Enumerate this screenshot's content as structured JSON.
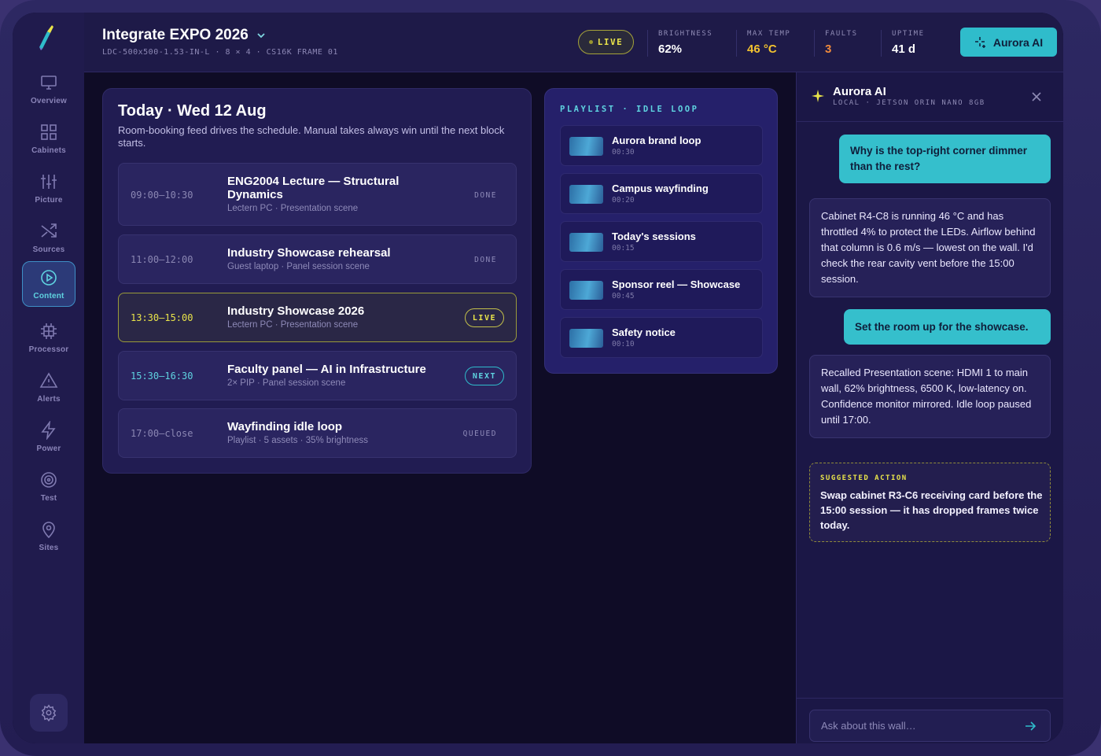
{
  "nav": {
    "items": [
      {
        "label": "Overview",
        "icon": "monitor-icon"
      },
      {
        "label": "Cabinets",
        "icon": "grid-icon"
      },
      {
        "label": "Picture",
        "icon": "sliders-icon"
      },
      {
        "label": "Sources",
        "icon": "shuffle-icon"
      },
      {
        "label": "Content",
        "icon": "play-circle-icon",
        "active": true
      },
      {
        "label": "Processor",
        "icon": "chip-icon"
      },
      {
        "label": "Alerts",
        "icon": "warning-icon"
      },
      {
        "label": "Power",
        "icon": "bolt-icon"
      },
      {
        "label": "Test",
        "icon": "target-icon"
      },
      {
        "label": "Sites",
        "icon": "map-pin-icon"
      }
    ]
  },
  "header": {
    "title": "Integrate EXPO 2026",
    "subtitle": "LDC-500x500-1.53-IN-L · 8 × 4 · CS16K FRAME 01",
    "live_label": "LIVE",
    "stats": [
      {
        "label": "BRIGHTNESS",
        "value": "62%",
        "color": "#ffffff"
      },
      {
        "label": "MAX TEMP",
        "value": "46 °C",
        "color": "#f2c230"
      },
      {
        "label": "FAULTS",
        "value": "3",
        "color": "#f08a3c"
      },
      {
        "label": "UPTIME",
        "value": "41 d",
        "color": "#ffffff"
      }
    ],
    "ai_button": "Aurora AI"
  },
  "schedule": {
    "title": "Today · Wed 12 Aug",
    "description": "Room-booking feed drives the schedule. Manual takes always win until the next block starts.",
    "rows": [
      {
        "time": "09:00–10:30",
        "title": "ENG2004 Lecture — Structural Dynamics",
        "sub": "Lectern PC · Presentation scene",
        "status": "DONE",
        "kind": "done"
      },
      {
        "time": "11:00–12:00",
        "title": "Industry Showcase rehearsal",
        "sub": "Guest laptop · Panel session scene",
        "status": "DONE",
        "kind": "done"
      },
      {
        "time": "13:30–15:00",
        "title": "Industry Showcase 2026",
        "sub": "Lectern PC · Presentation scene",
        "status": "LIVE",
        "kind": "live"
      },
      {
        "time": "15:30–16:30",
        "title": "Faculty panel — AI in Infrastructure",
        "sub": "2× PIP · Panel session scene",
        "status": "NEXT",
        "kind": "next"
      },
      {
        "time": "17:00–close",
        "title": "Wayfinding idle loop",
        "sub": "Playlist · 5 assets · 35% brightness",
        "status": "QUEUED",
        "kind": "queued"
      }
    ]
  },
  "playlist": {
    "header": "PLAYLIST · IDLE LOOP",
    "items": [
      {
        "name": "Aurora brand loop",
        "duration": "00:30"
      },
      {
        "name": "Campus wayfinding",
        "duration": "00:20"
      },
      {
        "name": "Today's sessions",
        "duration": "00:15"
      },
      {
        "name": "Sponsor reel — Showcase",
        "duration": "00:45"
      },
      {
        "name": "Safety notice",
        "duration": "00:10"
      }
    ]
  },
  "ai": {
    "title": "Aurora AI",
    "subtitle": "LOCAL · JETSON ORIN NANO 8GB",
    "messages": [
      {
        "role": "user",
        "text": "Why is the top-right corner dimmer than the rest?"
      },
      {
        "role": "assistant",
        "text": "Cabinet R4-C8 is running 46 °C and has throttled 4% to protect the LEDs. Airflow behind that column is 0.6 m/s — lowest on the wall. I'd check the rear cavity vent before the 15:00 session."
      },
      {
        "role": "user",
        "text": "Set the room up for the showcase."
      },
      {
        "role": "assistant",
        "text": "Recalled Presentation scene: HDMI 1 to main wall, 62% brightness, 6500 K, low-latency on. Confidence monitor mirrored. Idle loop paused until 17:00."
      }
    ],
    "suggested_label": "SUGGESTED ACTION",
    "suggested_text": "Swap cabinet R3-C6 receiving card before the 15:00 session — it has dropped frames twice today.",
    "input_placeholder": "Ask about this wall…"
  }
}
